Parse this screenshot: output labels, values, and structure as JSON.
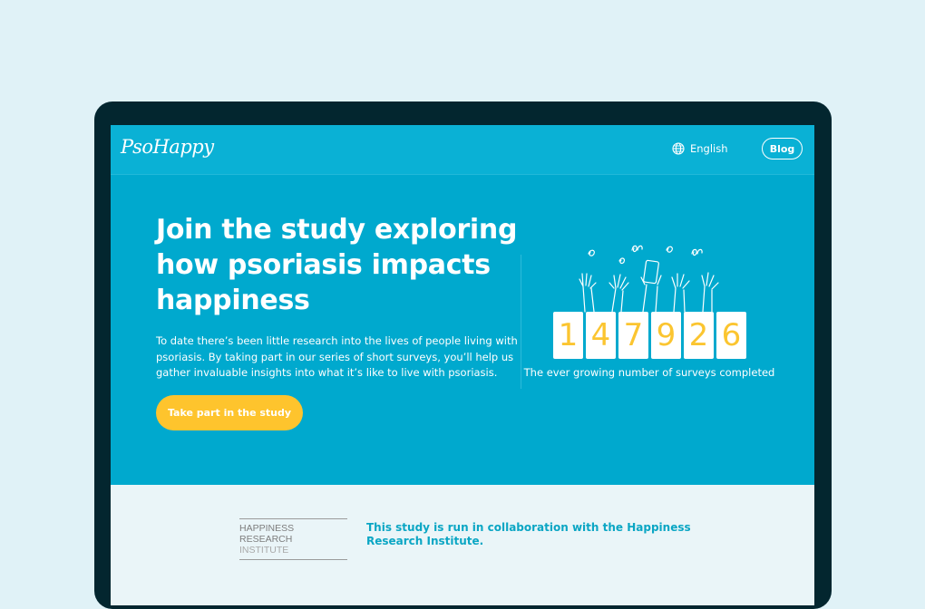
{
  "header": {
    "logo": "PsoHappy",
    "language": "English",
    "blog_label": "Blog"
  },
  "hero": {
    "title": "Join the study exploring how psoriasis impacts happiness",
    "description": "To date there’s been little research into the lives of people living with psoriasis. By taking part in our series of short surveys, you’ll help us gather invaluable insights into what it’s like to live with psoriasis.",
    "cta_label": "Take part in the study"
  },
  "counter": {
    "digits": [
      "1",
      "4",
      "7",
      "9",
      "2",
      "6"
    ],
    "caption": "The ever growing number of surveys completed"
  },
  "partner": {
    "logo_line1": "HAPPINESS RESEARCH",
    "logo_line2": "INSTITUTE",
    "text": "This study is run in collaboration with the Happiness Research Institute."
  },
  "colors": {
    "page_bg": "#e0f2f7",
    "device_frame": "#03262f",
    "brand_blue": "#00a9ce",
    "cta_yellow": "#fec42d",
    "digit_yellow": "#fbc530",
    "partner_text": "#0ba6c4"
  },
  "icons": {
    "language": "globe-icon",
    "illustration": "raised-hands-illustration"
  }
}
